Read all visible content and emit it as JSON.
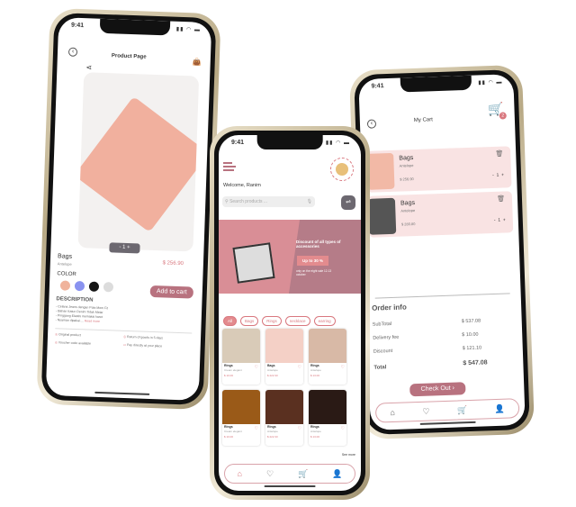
{
  "status": {
    "time": "9:41"
  },
  "product_page": {
    "title": "Product Page",
    "name": "Bags",
    "brand": "Antelope",
    "price": "$ 256.90",
    "quantity": "1",
    "color_label": "COLOR",
    "colors": [
      "#f0b39c",
      "#8a93f0",
      "#151515",
      "#dcdcdc"
    ],
    "add_to_cart": "Add to cart",
    "description_label": "DESCRIPTION",
    "description": [
      "- Celana Jeans dengan Pola Mom Fit",
      "- Bahan Katun Denim Tidak Melar",
      "- Pinggang Elastis memakai karet",
      "- Nyaman dipakai...."
    ],
    "read_more": "Read more",
    "features": [
      "Original product",
      "Return of goods in 5 days",
      "Voucher code available",
      "Pay directly at your place"
    ]
  },
  "home": {
    "welcome": "Welcome, Ranim",
    "search_placeholder": "Search products ...",
    "banner_title": "Discount of all types of accessories",
    "banner_badge": "Up to 30 %",
    "banner_note": "only on the eight sale 12-13 october",
    "chips": [
      "All",
      "Bags",
      "Rings",
      "necklace",
      "earring"
    ],
    "products": [
      {
        "name": "Rings",
        "sub": "Cream elegant",
        "price": "$ 10.00",
        "color": "#d9cbb8"
      },
      {
        "name": "Bags",
        "sub": "Antelope",
        "price": "$ 222.33",
        "color": "#f4d0c6"
      },
      {
        "name": "Rings",
        "sub": "Antelope",
        "price": "$ 13.00",
        "color": "#d8b9a6"
      },
      {
        "name": "Rings",
        "sub": "Cream elegant",
        "price": "$ 10.00",
        "color": "#9a5a18"
      },
      {
        "name": "Rings",
        "sub": "Antelope",
        "price": "$ 222.33",
        "color": "#5a3020"
      },
      {
        "name": "Rings",
        "sub": "Antelope",
        "price": "$ 13.00",
        "color": "#2a1a15"
      }
    ],
    "see_more": "See more"
  },
  "cart": {
    "title": "My Cart",
    "badge": "2",
    "items": [
      {
        "name": "Bags",
        "brand": "Antelope",
        "price": "$ 256.90",
        "qty": "1",
        "color": "#f2b9a6"
      },
      {
        "name": "Bags",
        "brand": "Antelope",
        "price": "$ 280.80",
        "qty": "1",
        "color": "#555"
      }
    ],
    "order_info": "Order info",
    "rows": [
      {
        "label": "SubTotal",
        "value": "$ 537.08"
      },
      {
        "label": "Delivery fee",
        "value": "$ 10.00"
      },
      {
        "label": "Discount",
        "value": "$ 121.10"
      }
    ],
    "total_label": "Total",
    "total_value": "$ 547.08",
    "checkout": "Check Out"
  },
  "colors": {
    "accent": "#b8727f",
    "pink": "#d9787f",
    "banner": "#d98e96"
  }
}
